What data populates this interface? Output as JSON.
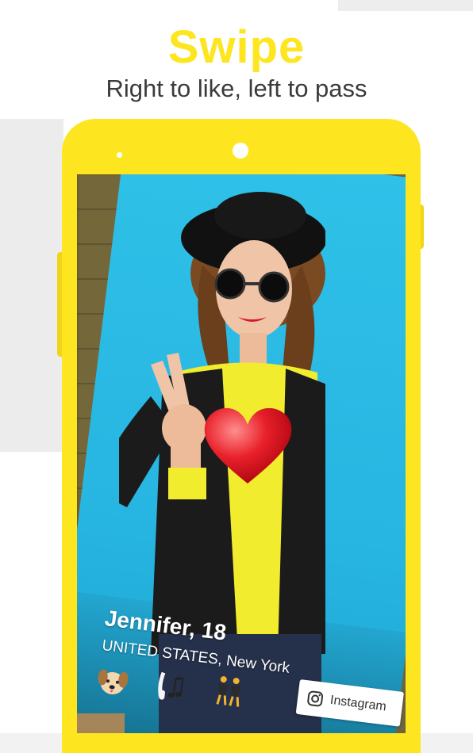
{
  "header": {
    "title": "Swipe",
    "subtitle": "Right to like, left to pass"
  },
  "profile": {
    "name_age": "Jennifer, 18",
    "location": "UNITED STATES, New York",
    "interests": [
      "dog-emoji-icon",
      "headphones-music-icon",
      "dancers-emoji-icon"
    ],
    "instagram_label": "Instagram"
  },
  "colors": {
    "brand_yellow": "#fde61f",
    "subtitle_text": "#3b3b3b",
    "card_background": "#2fc1e8",
    "heart_red": "#e8202a"
  }
}
